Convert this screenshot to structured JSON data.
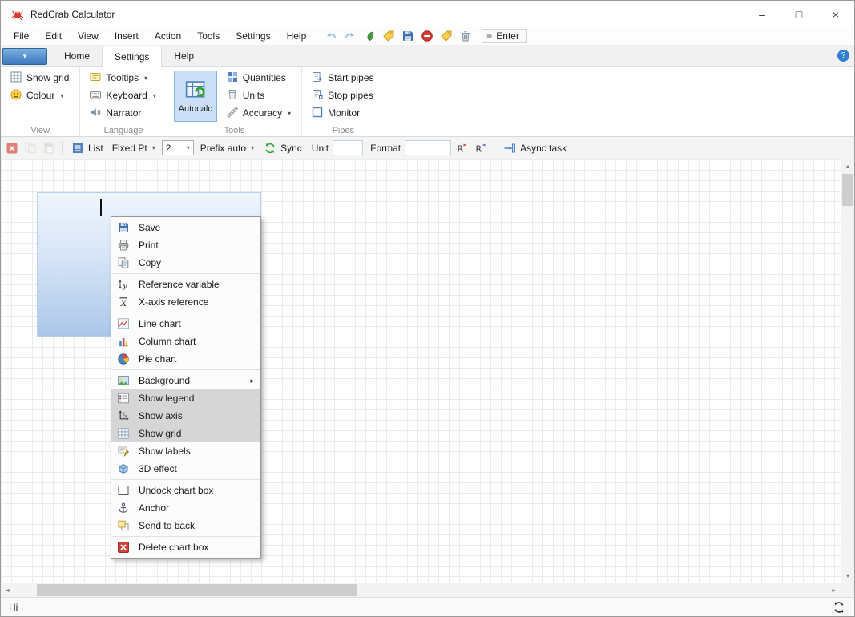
{
  "window": {
    "title": "RedCrab Calculator",
    "minimize": "–",
    "maximize": "□",
    "close": "×"
  },
  "menubar": {
    "items": [
      "File",
      "Edit",
      "View",
      "Insert",
      "Action",
      "Tools",
      "Settings",
      "Help"
    ],
    "icons": [
      {
        "name": "undo-icon",
        "icon": "undo"
      },
      {
        "name": "redo-icon",
        "icon": "redo"
      },
      {
        "name": "leaf-icon",
        "icon": "leaf"
      },
      {
        "name": "tag-icon",
        "icon": "tag"
      },
      {
        "name": "save-icon",
        "icon": "save"
      },
      {
        "name": "stop-icon",
        "icon": "stop"
      },
      {
        "name": "label-icon",
        "icon": "tag"
      },
      {
        "name": "trash-icon",
        "icon": "trash"
      }
    ],
    "enter": {
      "label": "Enter"
    }
  },
  "tabs": {
    "items": [
      {
        "label": "Home",
        "active": false
      },
      {
        "label": "Settings",
        "active": true
      },
      {
        "label": "Help",
        "active": false
      }
    ],
    "help_badge": "?"
  },
  "ribbon": {
    "groups": [
      {
        "label": "View",
        "items": [
          {
            "label": "Show grid",
            "icon": "grid"
          },
          {
            "label": "Colour",
            "icon": "smiley",
            "dropdown": true
          }
        ]
      },
      {
        "label": "Language",
        "items": [
          {
            "label": "Tooltips",
            "icon": "tooltip",
            "dropdown": true
          },
          {
            "label": "Keyboard",
            "icon": "keyboard",
            "dropdown": true
          },
          {
            "label": "Narrator",
            "icon": "speaker"
          }
        ]
      },
      {
        "label": "Tools",
        "big": {
          "label": "Autocalc",
          "icon": "autocalc"
        },
        "items": [
          {
            "label": "Quantities",
            "icon": "quantities"
          },
          {
            "label": "Units",
            "icon": "units"
          },
          {
            "label": "Accuracy",
            "icon": "accuracy",
            "dropdown": true
          }
        ]
      },
      {
        "label": "Pipes",
        "items": [
          {
            "label": "Start pipes",
            "icon": "start-pipes"
          },
          {
            "label": "Stop pipes",
            "icon": "stop-pipes"
          },
          {
            "label": "Monitor",
            "icon": "monitor"
          }
        ]
      }
    ]
  },
  "toolbar": {
    "list": "List",
    "fixed": "Fixed Pt",
    "precision": "2",
    "prefix": "Prefix auto",
    "sync": "Sync",
    "unit_label": "Unit",
    "unit_value": "",
    "format_label": "Format",
    "format_value": "",
    "async": "Async task"
  },
  "context_menu": {
    "items": [
      {
        "type": "item",
        "label": "Save",
        "icon": "save"
      },
      {
        "type": "item",
        "label": "Print",
        "icon": "print"
      },
      {
        "type": "item",
        "label": "Copy",
        "icon": "copy"
      },
      {
        "type": "sep"
      },
      {
        "type": "item",
        "label": "Reference variable",
        "icon": "reference-variable"
      },
      {
        "type": "item",
        "label": "X-axis reference",
        "icon": "x-axis-reference"
      },
      {
        "type": "sep"
      },
      {
        "type": "item",
        "label": "Line chart",
        "icon": "line-chart"
      },
      {
        "type": "item",
        "label": "Column chart",
        "icon": "column-chart"
      },
      {
        "type": "item",
        "label": "Pie chart",
        "icon": "pie-chart"
      },
      {
        "type": "sep"
      },
      {
        "type": "item",
        "label": "Background",
        "icon": "background",
        "submenu": true
      },
      {
        "type": "item",
        "label": "Show legend",
        "icon": "legend",
        "toggled": true
      },
      {
        "type": "item",
        "label": "Show axis",
        "icon": "axis",
        "toggled": true
      },
      {
        "type": "item",
        "label": "Show grid",
        "icon": "grid-small",
        "toggled": true
      },
      {
        "type": "item",
        "label": "Show labels",
        "icon": "labels"
      },
      {
        "type": "item",
        "label": "3D effect",
        "icon": "threed"
      },
      {
        "type": "sep"
      },
      {
        "type": "item",
        "label": "Undock chart box",
        "icon": "undock"
      },
      {
        "type": "item",
        "label": "Anchor",
        "icon": "anchor"
      },
      {
        "type": "item",
        "label": "Send to back",
        "icon": "send-back"
      },
      {
        "type": "sep"
      },
      {
        "type": "item",
        "label": "Delete chart box",
        "icon": "delete-box"
      }
    ]
  },
  "statusbar": {
    "text": "Hi"
  },
  "colors": {
    "accent_blue": "#4f81bd",
    "toggle_gray": "#d6d6d6",
    "crab_red": "#d63a2f"
  }
}
